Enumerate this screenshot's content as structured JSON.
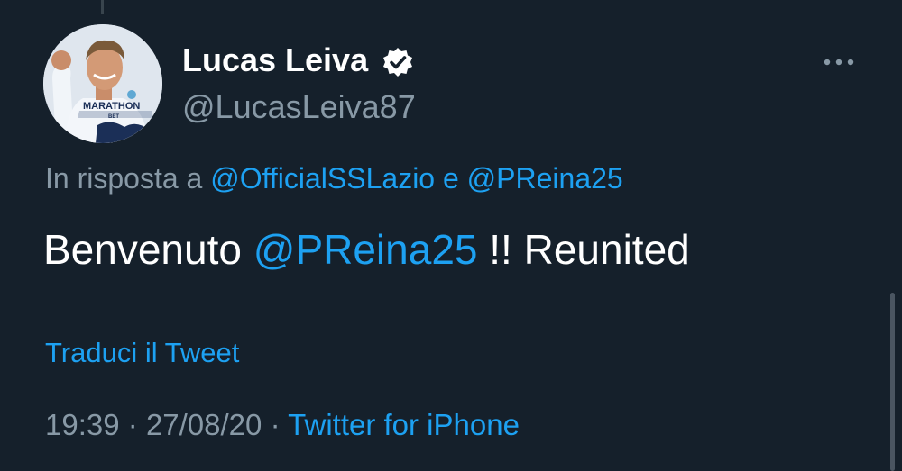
{
  "tweet": {
    "author": {
      "display_name": "Lucas Leiva",
      "handle": "@LucasLeiva87",
      "verified": true,
      "avatar_jersey_text": "MARATHON",
      "avatar_jersey_subtext": "BET"
    },
    "reply_to": {
      "prefix": "In risposta a",
      "mentions": [
        "@OfficialSSLazio",
        "@PReina25"
      ],
      "conjunction": "e"
    },
    "body": {
      "text_before": "Benvenuto",
      "mention": "@PReina25",
      "text_after": "!! Reunited"
    },
    "translate_label": "Traduci il Tweet",
    "meta": {
      "time": "19:39",
      "separator": "·",
      "date": "27/08/20",
      "source": "Twitter for iPhone"
    }
  },
  "icons": {
    "verified": "verified-badge-icon",
    "more": "more-horizontal-icon"
  },
  "colors": {
    "background": "#15202b",
    "primary_text": "#ffffff",
    "secondary_text": "#8899a6",
    "accent": "#1da1f2"
  }
}
